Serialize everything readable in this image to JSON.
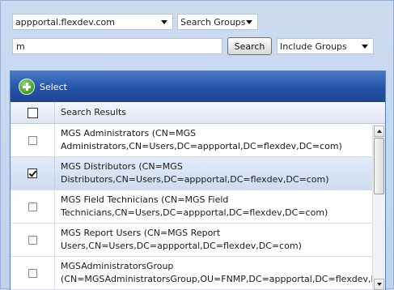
{
  "filters": {
    "domain_value": "appportal.flexdev.com",
    "scope_value": "Search Groups",
    "search_text": "m",
    "search_label": "Search",
    "group_option_value": "Include Groups"
  },
  "toolbar": {
    "select_label": "Select",
    "select_icon": "add-circle-icon"
  },
  "grid": {
    "header_label": "Search Results",
    "rows": [
      {
        "line1": "MGS Administrators (CN=MGS",
        "line2": "Administrators,CN=Users,DC=appportal,DC=flexdev,DC=com)",
        "checked": false
      },
      {
        "line1": "MGS Distributors (CN=MGS",
        "line2": "Distributors,CN=Users,DC=appportal,DC=flexdev,DC=com)",
        "checked": true
      },
      {
        "line1": "MGS Field Technicians (CN=MGS Field",
        "line2": "Technicians,CN=Users,DC=appportal,DC=flexdev,DC=com)",
        "checked": false
      },
      {
        "line1": "MGS Report Users (CN=MGS Report",
        "line2": "Users,CN=Users,DC=appportal,DC=flexdev,DC=com)",
        "checked": false
      },
      {
        "line1": "MGSAdministratorsGroup",
        "line2": "(CN=MGSAdministratorsGroup,OU=FNMP,DC=appportal,DC=flexdev,DC=com)",
        "checked": false
      }
    ]
  },
  "colors": {
    "toolbar": "#2553a8",
    "selected_row": "#d6e2f3",
    "background": "#c9d8ee"
  }
}
